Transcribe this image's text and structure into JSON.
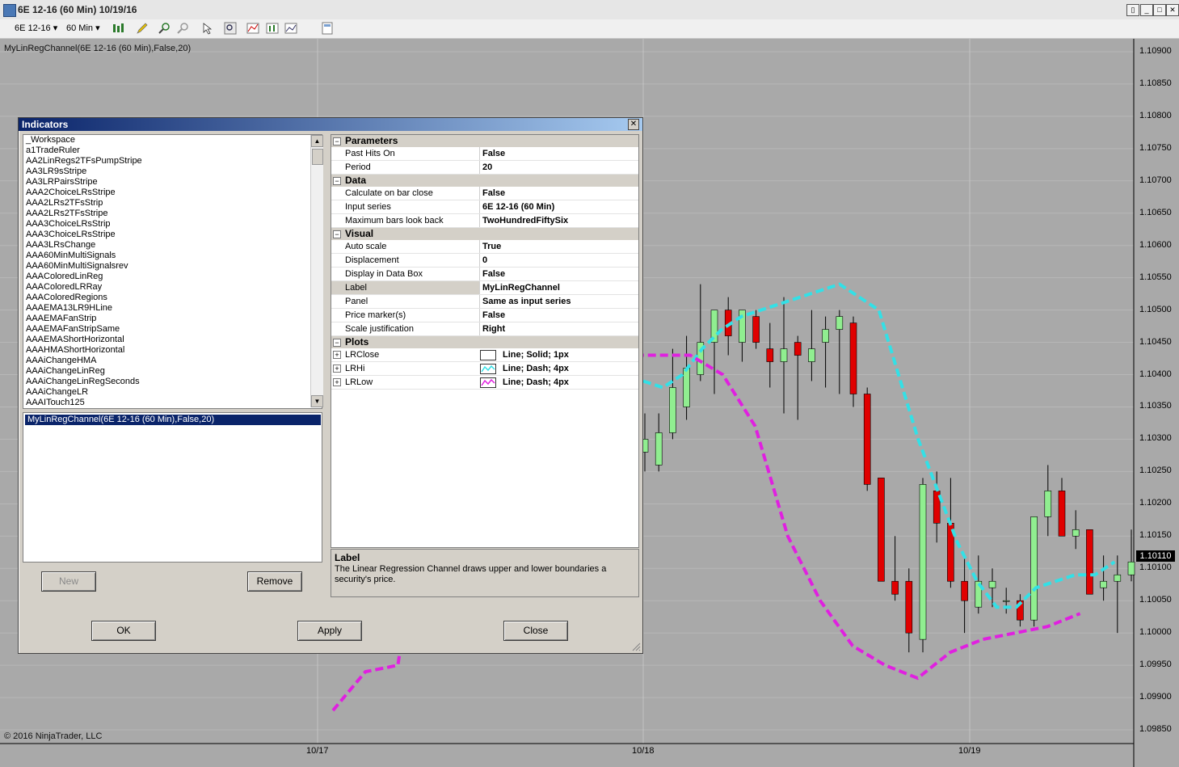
{
  "window": {
    "title": "6E 12-16 (60 Min)  10/19/16",
    "icon": "chart-app-icon",
    "buttons": [
      "restore-icon",
      "minimize-icon",
      "maximize-icon",
      "close-icon"
    ]
  },
  "toolbar": {
    "instrument": "6E 12-16",
    "interval": "60 Min",
    "icons": [
      "bar-style-icon",
      "drawing-pencil-icon",
      "zoom-in-icon",
      "zoom-out-icon",
      "pointer-icon",
      "magnify-icon",
      "indicators-icon",
      "strategies-icon",
      "properties-icon",
      "data-box-icon"
    ]
  },
  "chart": {
    "indicator_label": "MyLinRegChannel(6E 12-16 (60 Min),False,20)",
    "copyright": "© 2016 NinjaTrader, LLC",
    "price_marker": "1.10110",
    "colors": {
      "background": "#a9a9a9",
      "up_candle": "#90ee90",
      "down_candle": "#e00000",
      "lrhi": "#33e0e6",
      "lrlow": "#e020e0"
    }
  },
  "chart_data": {
    "type": "candlestick",
    "y_ticks": [
      "1.10900",
      "1.10850",
      "1.10800",
      "1.10750",
      "1.10700",
      "1.10650",
      "1.10600",
      "1.10550",
      "1.10500",
      "1.10450",
      "1.10400",
      "1.10350",
      "1.10300",
      "1.10250",
      "1.10200",
      "1.10150",
      "1.10100",
      "1.10050",
      "1.10000",
      "1.09950",
      "1.09900",
      "1.09850"
    ],
    "x_ticks": [
      "10/17",
      "10/18",
      "10/19"
    ],
    "ylim": [
      1.0983,
      1.1092
    ],
    "candles": [
      {
        "o": 1.1028,
        "h": 1.1034,
        "l": 1.1025,
        "c": 1.103
      },
      {
        "o": 1.1026,
        "h": 1.1034,
        "l": 1.1025,
        "c": 1.1031
      },
      {
        "o": 1.1031,
        "h": 1.1044,
        "l": 1.103,
        "c": 1.1038
      },
      {
        "o": 1.1035,
        "h": 1.1046,
        "l": 1.1033,
        "c": 1.1041
      },
      {
        "o": 1.104,
        "h": 1.1054,
        "l": 1.1039,
        "c": 1.1045
      },
      {
        "o": 1.1045,
        "h": 1.105,
        "l": 1.1037,
        "c": 1.105
      },
      {
        "o": 1.105,
        "h": 1.1052,
        "l": 1.1043,
        "c": 1.1046
      },
      {
        "o": 1.1045,
        "h": 1.105,
        "l": 1.1042,
        "c": 1.105
      },
      {
        "o": 1.1049,
        "h": 1.105,
        "l": 1.1044,
        "c": 1.1045
      },
      {
        "o": 1.1044,
        "h": 1.1048,
        "l": 1.1038,
        "c": 1.1042
      },
      {
        "o": 1.1042,
        "h": 1.1052,
        "l": 1.1034,
        "c": 1.1044
      },
      {
        "o": 1.1045,
        "h": 1.1046,
        "l": 1.1033,
        "c": 1.1043
      },
      {
        "o": 1.1042,
        "h": 1.105,
        "l": 1.1039,
        "c": 1.1044
      },
      {
        "o": 1.1045,
        "h": 1.1049,
        "l": 1.1038,
        "c": 1.1047
      },
      {
        "o": 1.1047,
        "h": 1.105,
        "l": 1.1037,
        "c": 1.1049
      },
      {
        "o": 1.1048,
        "h": 1.1049,
        "l": 1.1035,
        "c": 1.1037
      },
      {
        "o": 1.1037,
        "h": 1.1038,
        "l": 1.1022,
        "c": 1.1023
      },
      {
        "o": 1.1024,
        "h": 1.1024,
        "l": 1.1008,
        "c": 1.1008
      },
      {
        "o": 1.1008,
        "h": 1.1015,
        "l": 1.1005,
        "c": 1.1006
      },
      {
        "o": 1.1008,
        "h": 1.101,
        "l": 1.0997,
        "c": 1.1
      },
      {
        "o": 1.0999,
        "h": 1.1024,
        "l": 1.0997,
        "c": 1.1023
      },
      {
        "o": 1.1022,
        "h": 1.1025,
        "l": 1.1014,
        "c": 1.1017
      },
      {
        "o": 1.1017,
        "h": 1.1024,
        "l": 1.1007,
        "c": 1.1008
      },
      {
        "o": 1.1008,
        "h": 1.1012,
        "l": 1.1,
        "c": 1.1005
      },
      {
        "o": 1.1004,
        "h": 1.1012,
        "l": 1.1003,
        "c": 1.1008
      },
      {
        "o": 1.1007,
        "h": 1.101,
        "l": 1.1004,
        "c": 1.1008
      },
      {
        "o": 1.1005,
        "h": 1.1007,
        "l": 1.1003,
        "c": 1.1005
      },
      {
        "o": 1.1005,
        "h": 1.1006,
        "l": 1.1001,
        "c": 1.1002
      },
      {
        "o": 1.1002,
        "h": 1.1018,
        "l": 1.1001,
        "c": 1.1018
      },
      {
        "o": 1.1018,
        "h": 1.1026,
        "l": 1.1015,
        "c": 1.1022
      },
      {
        "o": 1.1022,
        "h": 1.1024,
        "l": 1.1015,
        "c": 1.1015
      },
      {
        "o": 1.1015,
        "h": 1.1019,
        "l": 1.1013,
        "c": 1.1016
      },
      {
        "o": 1.1016,
        "h": 1.1016,
        "l": 1.1006,
        "c": 1.1006
      },
      {
        "o": 1.1007,
        "h": 1.1012,
        "l": 1.1005,
        "c": 1.1008
      },
      {
        "o": 1.1008,
        "h": 1.1012,
        "l": 1.1,
        "c": 1.1009
      },
      {
        "o": 1.1009,
        "h": 1.1016,
        "l": 1.1008,
        "c": 1.1011
      }
    ],
    "series": [
      {
        "name": "LRHi",
        "values": [
          1.1039,
          1.1038,
          1.104,
          1.1044,
          1.1047,
          1.1049,
          1.105,
          1.1051,
          1.1052,
          1.1053,
          1.1054,
          1.1052,
          1.105,
          1.104,
          1.103,
          1.1022,
          1.1014,
          1.1008,
          1.1004,
          1.1004,
          1.1007,
          1.1008,
          1.1009,
          1.1009,
          1.1011
        ]
      },
      {
        "name": "LRLow",
        "values": [
          1.0988,
          1.0994,
          1.0995,
          1.1029,
          1.103,
          1.1036,
          1.1041,
          1.1043,
          1.1043,
          1.1043,
          1.1043,
          1.1043,
          1.104,
          1.1032,
          1.1015,
          1.1005,
          1.0998,
          1.0995,
          1.0993,
          1.0997,
          1.0999,
          1.1,
          1.1001,
          1.1003
        ]
      }
    ]
  },
  "dialog": {
    "title": "Indicators",
    "indicators": [
      "_Workspace",
      "a1TradeRuler",
      "AA2LinRegs2TFsPumpStripe",
      "AA3LR9sStripe",
      "AA3LRPairsStripe",
      "AAA2ChoiceLRsStripe",
      "AAA2LRs2TFsStrip",
      "AAA2LRs2TFsStripe",
      "AAA3ChoiceLRsStrip",
      "AAA3ChoiceLRsStripe",
      "AAA3LRsChange",
      "AAA60MinMultiSignals",
      "AAA60MinMultiSignalsrev",
      "AAAColoredLinReg",
      "AAAColoredLRRay",
      "AAAColoredRegions",
      "AAAEMA13LR9HLine",
      "AAAEMAFanStrip",
      "AAAEMAFanStripSame",
      "AAAEMAShortHorizontal",
      "AAAHMAShortHorizontal",
      "AAAiChangeHMA",
      "AAAiChangeLinReg",
      "AAAiChangeLinRegSeconds",
      "AAAiChangeLR",
      "AAAITouch125"
    ],
    "applied": "MyLinRegChannel(6E 12-16 (60 Min),False,20)",
    "new_label": "New",
    "remove_label": "Remove",
    "ok_label": "OK",
    "apply_label": "Apply",
    "close_label": "Close",
    "categories": [
      {
        "name": "Parameters",
        "rows": [
          {
            "name": "Past Hits On",
            "value": "False"
          },
          {
            "name": "Period",
            "value": "20"
          }
        ]
      },
      {
        "name": "Data",
        "rows": [
          {
            "name": "Calculate on bar close",
            "value": "False"
          },
          {
            "name": "Input series",
            "value": "6E 12-16 (60 Min)"
          },
          {
            "name": "Maximum bars look back",
            "value": "TwoHundredFiftySix"
          }
        ]
      },
      {
        "name": "Visual",
        "rows": [
          {
            "name": "Auto scale",
            "value": "True"
          },
          {
            "name": "Displacement",
            "value": "0"
          },
          {
            "name": "Display in Data Box",
            "value": "False"
          },
          {
            "name": "Label",
            "value": "MyLinRegChannel"
          },
          {
            "name": "Panel",
            "value": "Same as input series"
          },
          {
            "name": "Price marker(s)",
            "value": "False"
          },
          {
            "name": "Scale justification",
            "value": "Right"
          }
        ]
      },
      {
        "name": "Plots",
        "rows": [
          {
            "name": "LRClose",
            "value": "Line; Solid; 1px",
            "color": "#ffffff"
          },
          {
            "name": "LRHi",
            "value": "Line; Dash; 4px",
            "color": "#33e0e6"
          },
          {
            "name": "LRLow",
            "value": "Line; Dash; 4px",
            "color": "#e020e0"
          }
        ]
      }
    ],
    "description_title": "Label",
    "description_text": "The Linear Regression Channel draws upper and lower boundaries a security's price."
  }
}
